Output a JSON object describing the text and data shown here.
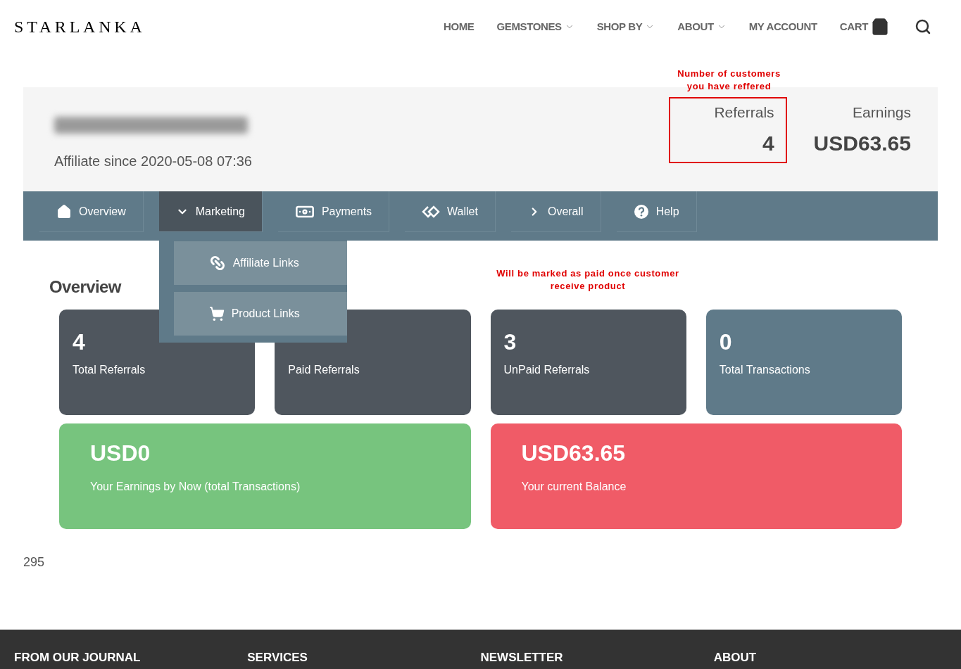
{
  "header": {
    "logo": "STARLANKA",
    "menu": [
      {
        "label": "HOME",
        "dropdown": false
      },
      {
        "label": "GEMSTONES",
        "dropdown": true
      },
      {
        "label": "SHOP BY",
        "dropdown": true
      },
      {
        "label": "ABOUT",
        "dropdown": true
      },
      {
        "label": "MY ACCOUNT",
        "dropdown": false
      },
      {
        "label": "CART",
        "dropdown": false
      }
    ]
  },
  "profile": {
    "since": "Affiliate since 2020-05-08 07:36",
    "stats": [
      {
        "label": "Referrals",
        "value": "4",
        "highlighted": true,
        "note": "Number of customers you have reffered"
      },
      {
        "label": "Earnings",
        "value": "USD63.65",
        "highlighted": false
      }
    ]
  },
  "tabs": [
    {
      "label": "Overview",
      "selected": false
    },
    {
      "label": "Marketing",
      "selected": true,
      "expanded": true,
      "children": [
        {
          "label": "Affiliate Links"
        },
        {
          "label": "Product Links"
        }
      ]
    },
    {
      "label": "Payments",
      "selected": false
    },
    {
      "label": "Wallet",
      "selected": false
    },
    {
      "label": "Overall",
      "selected": false
    },
    {
      "label": "Help",
      "selected": false
    }
  ],
  "overview": {
    "title": "Overview",
    "note": "Will be marked as paid once customer receive product",
    "cards": [
      {
        "value": "4",
        "label": "Total Referrals",
        "color": "#4f565e"
      },
      {
        "label": "Paid Referrals",
        "color": "#4f565e"
      },
      {
        "value": "3",
        "label": "UnPaid Referrals",
        "color": "#4f565e"
      },
      {
        "value": "0",
        "label": "Total Transactions",
        "color": "#5f7a89"
      }
    ],
    "totals": [
      {
        "value": "USD0",
        "label": "Your Earnings by Now (total Transactions)",
        "color": "#77c47e"
      },
      {
        "value": "USD63.65",
        "label": "Your current Balance",
        "color": "#f05b67"
      }
    ]
  },
  "page_number": "295",
  "footer": [
    "FROM OUR JOURNAL",
    "SERVICES",
    "NEWSLETTER",
    "ABOUT"
  ]
}
